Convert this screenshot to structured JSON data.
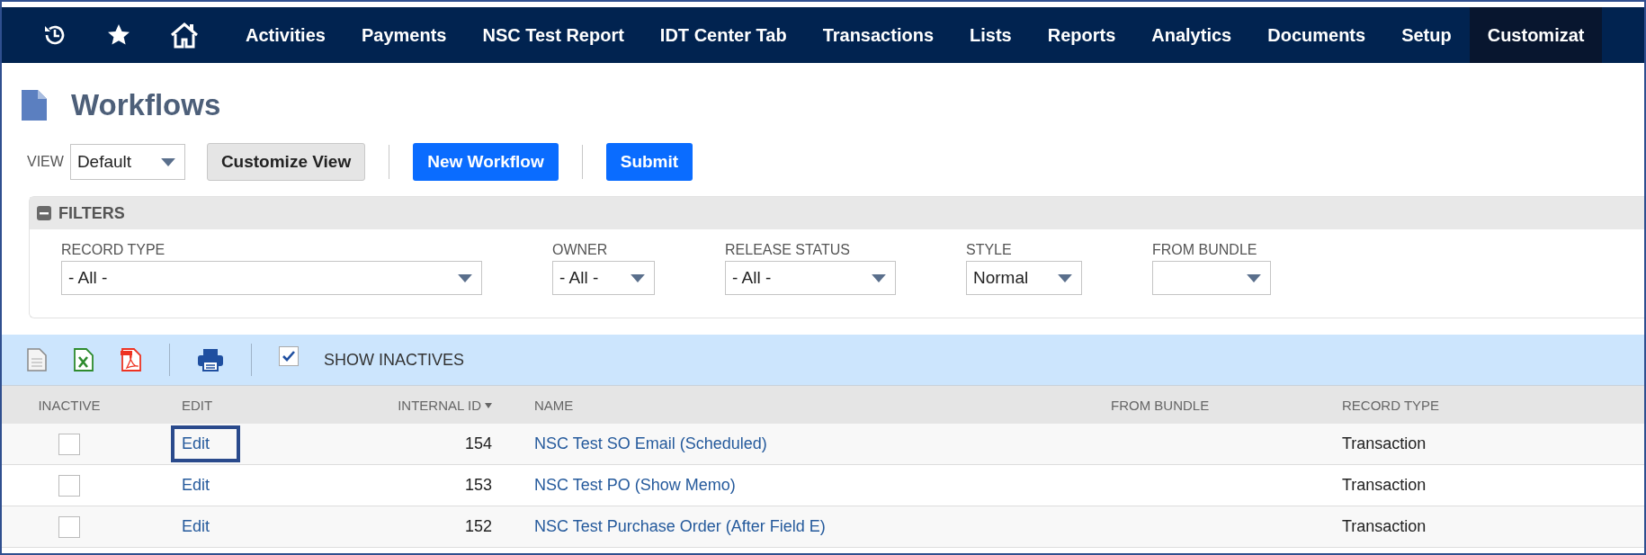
{
  "nav": {
    "items": [
      {
        "label": "Activities",
        "selected": false
      },
      {
        "label": "Payments",
        "selected": false
      },
      {
        "label": "NSC Test Report",
        "selected": false
      },
      {
        "label": "IDT Center Tab",
        "selected": false
      },
      {
        "label": "Transactions",
        "selected": false
      },
      {
        "label": "Lists",
        "selected": false
      },
      {
        "label": "Reports",
        "selected": false
      },
      {
        "label": "Analytics",
        "selected": false
      },
      {
        "label": "Documents",
        "selected": false
      },
      {
        "label": "Setup",
        "selected": false
      },
      {
        "label": "Customizat",
        "selected": true
      }
    ]
  },
  "page": {
    "title": "Workflows"
  },
  "view": {
    "label": "VIEW",
    "value": "Default"
  },
  "buttons": [
    {
      "label": "Customize View",
      "kind": "secondary"
    },
    {
      "label": "New Workflow",
      "kind": "primary"
    },
    {
      "label": "Submit",
      "kind": "primary"
    }
  ],
  "filters": {
    "title": "FILTERS",
    "expanded": true,
    "fields": [
      {
        "label": "RECORD TYPE",
        "value": "- All -"
      },
      {
        "label": "OWNER",
        "value": "- All -"
      },
      {
        "label": "RELEASE STATUS",
        "value": "- All -"
      },
      {
        "label": "STYLE",
        "value": "Normal"
      },
      {
        "label": "FROM BUNDLE"
      }
    ]
  },
  "toolbar": {
    "show_inactives": {
      "label": "SHOW INACTIVES",
      "checked": true
    }
  },
  "table": {
    "columns": [
      "INACTIVE",
      "EDIT",
      "INTERNAL ID",
      "NAME",
      "FROM BUNDLE",
      "RECORD TYPE"
    ],
    "rows": [
      {
        "inactive": false,
        "edit": "Edit",
        "highlighted": true,
        "internal_id": "154",
        "name": "NSC Test SO Email (Scheduled)",
        "record_type": "Transaction"
      },
      {
        "inactive": false,
        "edit": "Edit",
        "highlighted": false,
        "internal_id": "153",
        "name": "NSC Test PO (Show Memo)",
        "record_type": "Transaction"
      },
      {
        "inactive": false,
        "edit": "Edit",
        "highlighted": false,
        "internal_id": "152",
        "name": "NSC Test Purchase Order (After Field E)",
        "record_type": "Transaction"
      }
    ]
  }
}
